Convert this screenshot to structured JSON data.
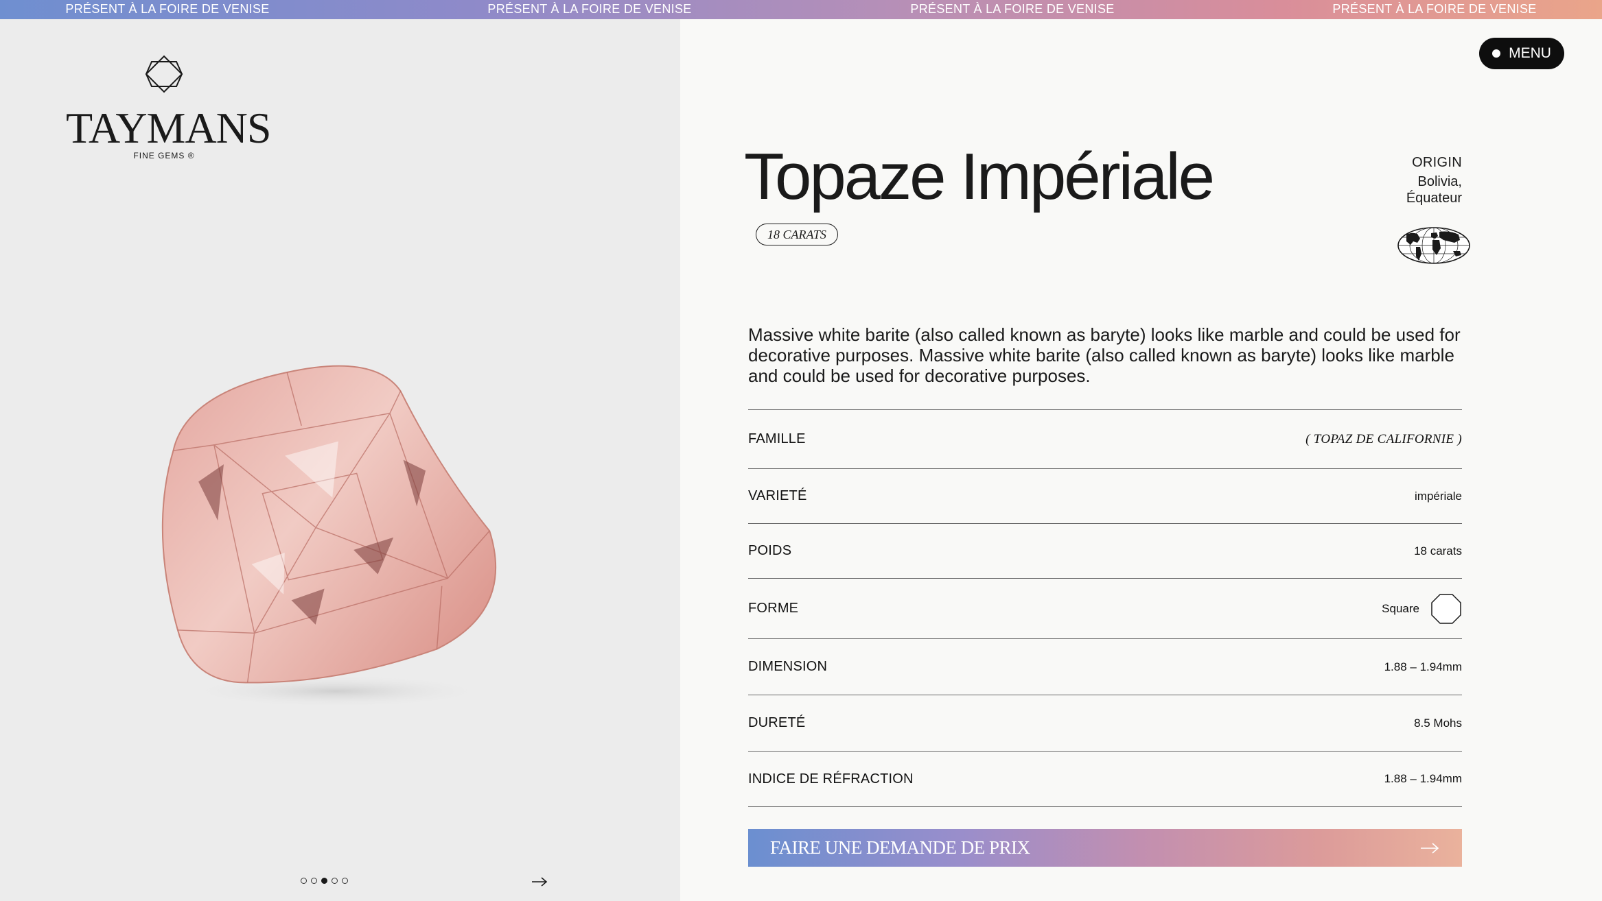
{
  "banner": {
    "items": [
      "PRÉSENT À LA FOIRE DE VENISE",
      "PRÉSENT À LA FOIRE DE VENISE",
      "PRÉSENT À LA FOIRE DE VENISE",
      "PRÉSENT À LA FOIRE DE VENISE"
    ]
  },
  "brand": {
    "name": "TAYMANS",
    "tagline": "FINE GEMS ®"
  },
  "gallery": {
    "slide_count": 5,
    "active_slide": 3,
    "next_icon": "arrow-right-icon"
  },
  "menu": {
    "label": "MENU"
  },
  "product": {
    "title": "Topaze Impériale",
    "carats_badge": "18 CARATS",
    "origin_label": "ORIGIN",
    "origin_line1": "Bolivia,",
    "origin_line2": "Équateur",
    "globe_icon": "globe-icon",
    "description": "Massive white barite (also called known as baryte) looks like marble and could be used for decorative purposes. Massive white barite (also called known as baryte) looks like marble and could be used for decorative purposes."
  },
  "specs": {
    "famille_label": "FAMILLE",
    "famille_value": "( TOPAZ DE CALIFORNIE )",
    "variete_label": "VARIETÉ",
    "variete_value": "impériale",
    "poids_label": "POIDS",
    "poids_value": "18 carats",
    "forme_label": "FORME",
    "forme_value": "Square",
    "forme_icon": "octagon-shape-icon",
    "dimension_label": "DIMENSION",
    "dimension_value": "1.88 – 1.94mm",
    "durete_label": "DURETÉ",
    "durete_value": "8.5 Mohs",
    "indice_label": "INDICE DE RÉFRACTION",
    "indice_value": "1.88 – 1.94mm"
  },
  "cta": {
    "label": "FAIRE UNE DEMANDE DE PRIX",
    "icon": "arrow-right-icon"
  },
  "colors": {
    "banner_gradient": [
      "#6f8fd0",
      "#b58fb8",
      "#eaa58a"
    ],
    "gem_color": "#e8a89a",
    "menu_bg": "#0e0e0e"
  }
}
